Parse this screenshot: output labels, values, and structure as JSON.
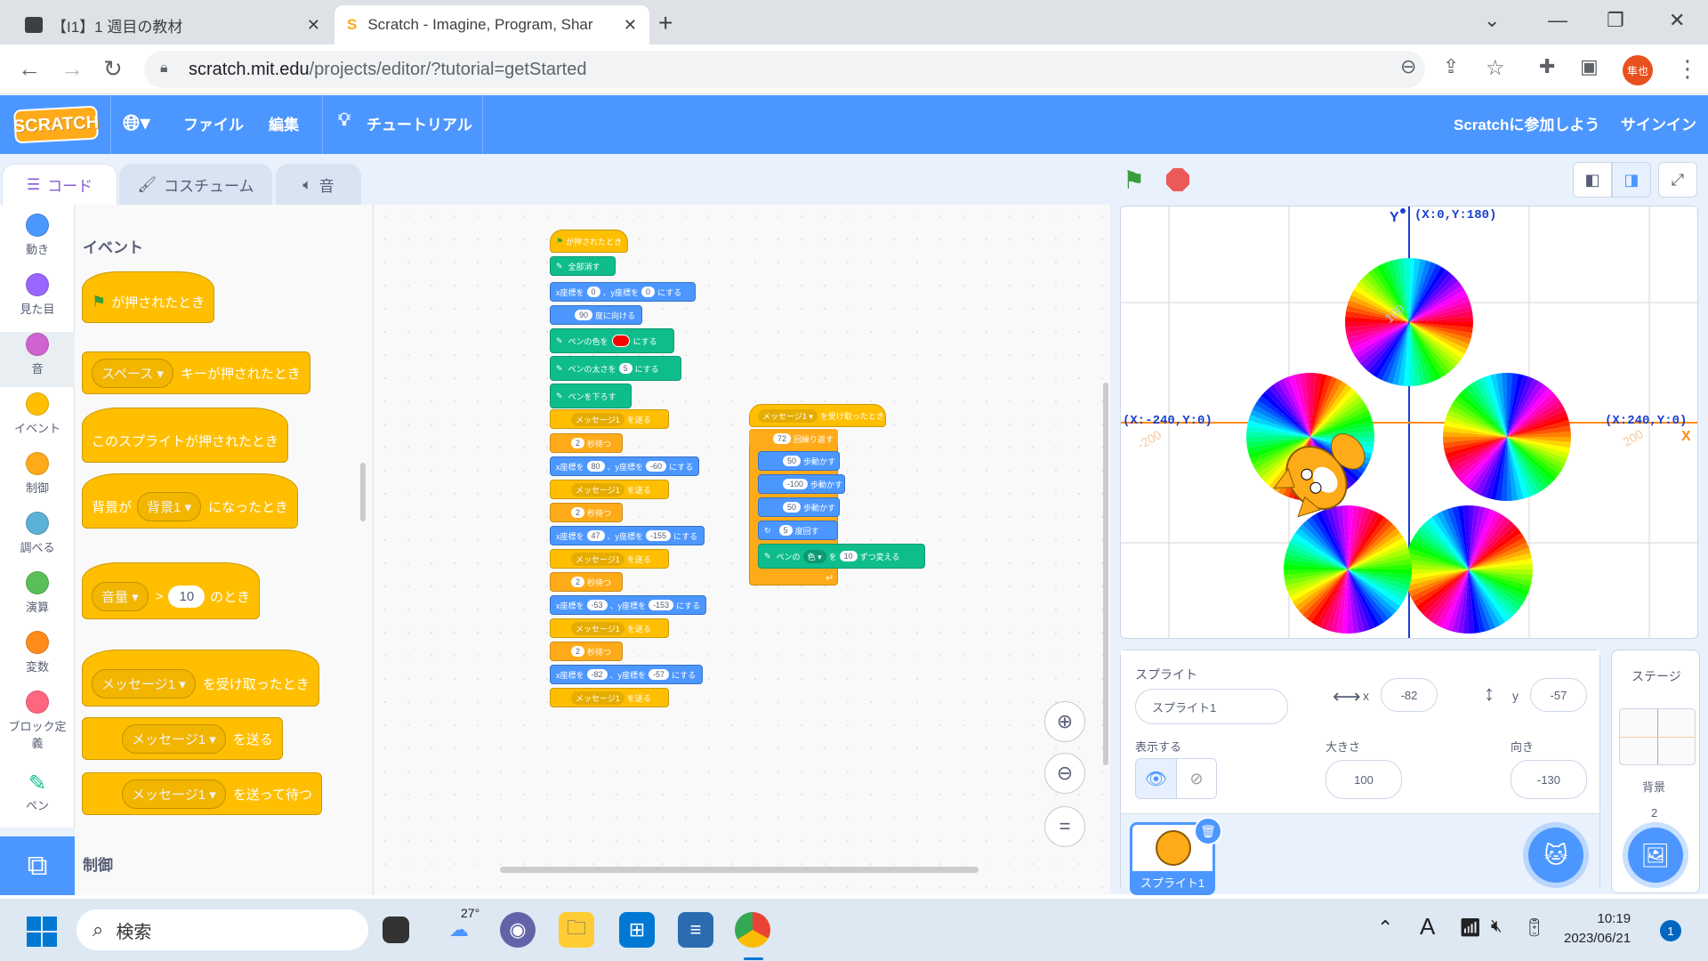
{
  "browser": {
    "tabs": [
      {
        "title": "【I1】1 週目の教材",
        "close": "✕"
      },
      {
        "title": "Scratch - Imagine, Program, Shar",
        "close": "✕"
      }
    ],
    "new_tab": "+",
    "url_host": "scratch.mit.edu",
    "url_path": "/projects/editor/?tutorial=getStarted",
    "avatar_text": "隼也"
  },
  "menu": {
    "logo": "SCRATCH",
    "file": "ファイル",
    "edit": "編集",
    "tutorial": "チュートリアル",
    "join": "Scratchに参加しよう",
    "signin": "サインイン"
  },
  "editor_tabs": {
    "code": "コード",
    "costume": "コスチューム",
    "sound": "音"
  },
  "categories": [
    {
      "label": "動き",
      "color": "#4c97ff"
    },
    {
      "label": "見た目",
      "color": "#9966ff"
    },
    {
      "label": "音",
      "color": "#cf63cf"
    },
    {
      "label": "イベント",
      "color": "#ffbf00"
    },
    {
      "label": "制御",
      "color": "#ffab19"
    },
    {
      "label": "調べる",
      "color": "#5cb1d6"
    },
    {
      "label": "演算",
      "color": "#59c059"
    },
    {
      "label": "変数",
      "color": "#ff8c1a"
    },
    {
      "label": "ブロック定義",
      "color": "#ff6680"
    },
    {
      "label": "ペン",
      "color": "#0fbd8c"
    }
  ],
  "flyout": {
    "heading": "イベント",
    "heading2": "制御",
    "flag_block": "が押されたとき",
    "key_dd": "スペース",
    "key_block": "キーが押されたとき",
    "sprite_click": "このスプライトが押されたとき",
    "backdrop_pre": "背景が",
    "backdrop_dd": "背景1",
    "backdrop_post": "になったとき",
    "loud_dd": "音量",
    "loud_op": ">",
    "loud_val": "10",
    "loud_post": "のとき",
    "msg_dd": "メッセージ1",
    "recv_post": "を受け取ったとき",
    "send_post": "を送る",
    "sendwait_post": "を送って待つ"
  },
  "script1": {
    "hat": "が押されたとき",
    "clear": "全部消す",
    "goto1": {
      "pre": "x座標を",
      "x": "0",
      "mid": "、y座標を",
      "y": "0",
      "post": "にする"
    },
    "point": {
      "val": "90",
      "post": "度に向ける"
    },
    "pencolor": {
      "pre": "ペンの色を",
      "post": "にする",
      "color": "#ff0000"
    },
    "pensize": {
      "pre": "ペンの太さを",
      "val": "5",
      "post": "にする"
    },
    "pendown": "ペンを下ろす",
    "msg": "メッセージ1",
    "send": "を送る",
    "wait": {
      "val": "2",
      "post": "秒待つ"
    },
    "gotos": [
      {
        "x": "80",
        "y": "-60"
      },
      {
        "x": "47",
        "y": "-155"
      },
      {
        "x": "-53",
        "y": "-153"
      },
      {
        "x": "-82",
        "y": "-57"
      }
    ]
  },
  "script2": {
    "hat_dd": "メッセージ1",
    "hat_post": "を受け取ったとき",
    "repeat": {
      "val": "72",
      "post": "回繰り返す"
    },
    "move1": {
      "val": "50",
      "post": "歩動かす"
    },
    "move2": {
      "val": "-100",
      "post": "歩動かす"
    },
    "move3": {
      "val": "50",
      "post": "歩動かす"
    },
    "turn": {
      "val": "5",
      "post": "度回す"
    },
    "change": {
      "pre": "ペンの",
      "dd": "色",
      "mid": "を",
      "val": "10",
      "post": "ずつ変える"
    }
  },
  "stage": {
    "y_axis": "Y",
    "x_axis": "X",
    "top": "(X:0,Y:180)",
    "left": "(X:-240,Y:0)",
    "right": "(X:240,Y:0)",
    "t100": "100",
    "t200": "200",
    "tm200": "-200"
  },
  "sprite": {
    "label": "スプライト",
    "name": "スプライト1",
    "x_label": "x",
    "x": "-82",
    "y_label": "y",
    "y": "-57",
    "show_label": "表示する",
    "size_label": "大きさ",
    "size": "100",
    "dir_label": "向き",
    "dir": "-130",
    "thumb_name": "スプライト1"
  },
  "stage_panel": {
    "title": "ステージ",
    "backdrop_label": "背景",
    "backdrop_count": "2"
  },
  "taskbar": {
    "search": "検索",
    "weather": "27°",
    "time": "10:19",
    "date": "2023/06/21",
    "notif": "1"
  }
}
